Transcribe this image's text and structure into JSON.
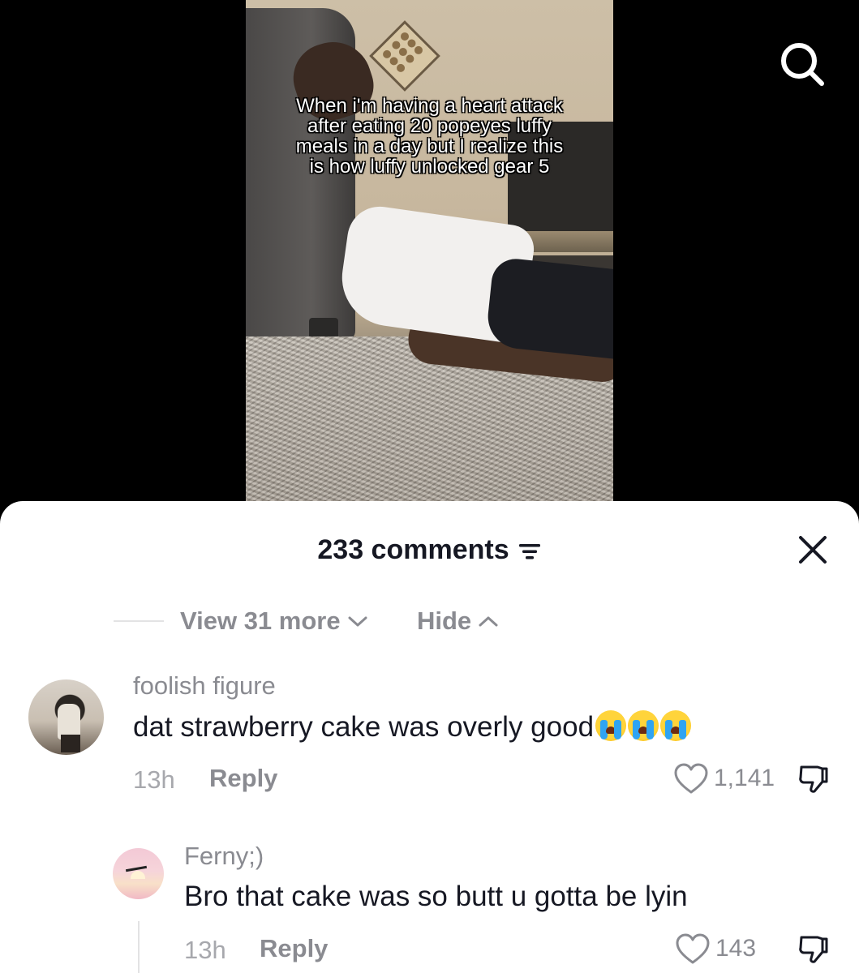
{
  "video": {
    "caption": "When i'm having a heart attack after eating 20 popeyes luffy meals in a day but I realize this is how luffy unlocked gear 5"
  },
  "header": {
    "comment_count_label": "233 comments"
  },
  "thread_controls": {
    "view_more_label": "View 31 more",
    "hide_label": "Hide"
  },
  "comments": [
    {
      "username": "foolish figure",
      "text": "dat strawberry cake was overly good",
      "emoji": "😭😭😭",
      "time": "13h",
      "reply_label": "Reply",
      "likes": "1,141"
    },
    {
      "username": "Ferny;)",
      "text": "Bro that cake was so butt u gotta be lyin",
      "time": "13h",
      "reply_label": "Reply",
      "likes": "143"
    }
  ],
  "icons": {
    "search": "search-icon",
    "filter": "filter-icon",
    "close": "close-icon",
    "chevron_down": "chevron-down-icon",
    "chevron_up": "chevron-up-icon",
    "heart": "heart-icon",
    "dislike": "thumbs-down-icon"
  },
  "colors": {
    "text_primary": "#161823",
    "text_secondary": "#8a8b91"
  }
}
